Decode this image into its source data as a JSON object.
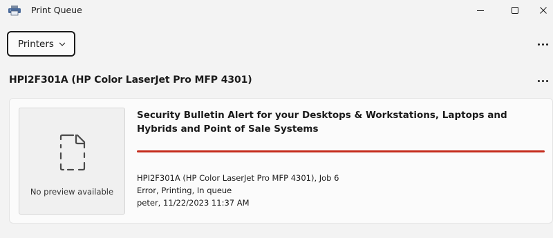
{
  "window": {
    "title": "Print Queue",
    "icon": "printer-icon",
    "controls": [
      "minimize-icon",
      "maximize-icon",
      "close-icon"
    ]
  },
  "toolbar": {
    "printers_label": "Printers",
    "more_icon": "more-options-icon"
  },
  "printer": {
    "name": "HPI2F301A (HP Color LaserJet Pro MFP 4301)",
    "more_icon": "more-options-icon"
  },
  "job": {
    "preview_text": "No preview available",
    "title": "Security Bulletin Alert for your Desktops & Workstations, Laptops and Hybrids and Point of Sale Systems",
    "progress_color": "#c42b1c",
    "details": [
      "HPI2F301A (HP Color LaserJet Pro MFP 4301), Job 6",
      "Error, Printing, In queue",
      "peter, 11/22/2023 11:37 AM"
    ]
  }
}
